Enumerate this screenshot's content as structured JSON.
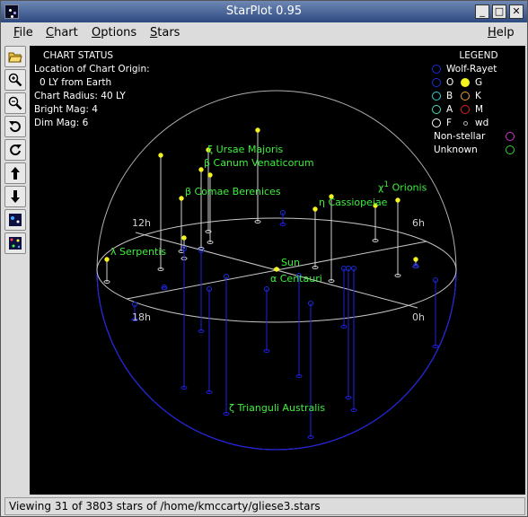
{
  "window": {
    "title": "StarPlot 0.95",
    "min_glyph": "_",
    "max_glyph": "□",
    "close_glyph": "✕"
  },
  "menu": {
    "file": "File",
    "chart": "Chart",
    "options": "Options",
    "stars": "Stars",
    "help": "Help"
  },
  "chart_status": {
    "heading": "CHART STATUS",
    "origin_label": "Location of Chart Origin:",
    "origin_value": "0 LY from Earth",
    "radius": "Chart Radius: 40 LY",
    "bright_mag": "Bright Mag: 4",
    "dim_mag": "Dim Mag: 6"
  },
  "legend": {
    "heading": "LEGEND",
    "wolf_rayet": "Wolf-Rayet",
    "o": "O",
    "g": "G",
    "b": "B",
    "k": "K",
    "a": "A",
    "m": "M",
    "f": "F",
    "wd": "wd",
    "non_stellar": "Non-stellar",
    "unknown": "Unknown",
    "colors": {
      "wolf_rayet": "#1a2dd8",
      "o": "#1a2dd8",
      "g": "#f5f51e",
      "b": "#3ad0d0",
      "k": "#e8a040",
      "a": "#44e0c0",
      "m": "#e02020",
      "f": "#ffffff",
      "wd": "#b0b0b0",
      "non_stellar": "#d030d0",
      "unknown": "#30d030"
    }
  },
  "ra_labels": {
    "r12h": "12h",
    "r6h": "6h",
    "r18h": "18h",
    "r0h": "0h"
  },
  "star_labels": {
    "xi_uma": "ξ Ursae Majoris",
    "beta_cvn": "β Canum Venaticorum",
    "beta_com": "β Comae Berenices",
    "eta_cas": "η Cassiopeiae",
    "chi1_ori": "χ",
    "chi1_sup": "1",
    "chi1_rest": " Orionis",
    "lambda_ser": "λ Serpentis",
    "sun": "Sun",
    "alpha_cen": "α Centauri",
    "zeta_tra": "ζ Trianguli Australis"
  },
  "status_bar": "Viewing 31 of 3803 stars of /home/kmccarty/gliese3.stars"
}
